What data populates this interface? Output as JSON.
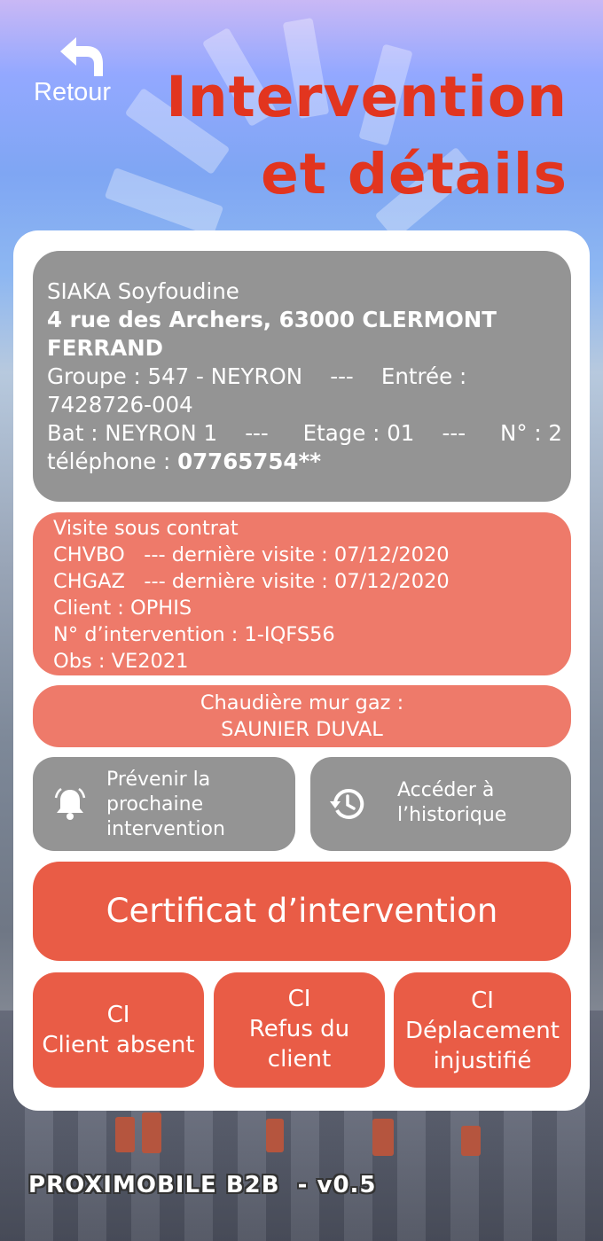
{
  "colors": {
    "title": "#e2351f",
    "info_box": "#949494",
    "contract_box": "#ee7a6a",
    "primary_button": "#e95c46",
    "card": "#ffffff"
  },
  "header": {
    "back_label": "Retour",
    "back_icon": "undo-arrow-icon",
    "title_line1": "Intervention",
    "title_line2": "et détails"
  },
  "client": {
    "name": "SIAKA Soyfoudine",
    "address_line1": "4 rue des Archers, 63000 CLERMONT",
    "address_line2": "FERRAND",
    "group_line": "Groupe : 547 - NEYRON    ---    Entrée :",
    "entry_value": "7428726-004",
    "building_line": "Bat : NEYRON 1    ---     Etage : 01    ---     N° : 2",
    "phone_label": "téléphone : ",
    "phone_value": "07765754**"
  },
  "contract": {
    "title": "Visite sous contrat",
    "line1": "CHVBO   --- dernière visite : 07/12/2020",
    "line2": "CHGAZ   --- dernière visite : 07/12/2020",
    "client": "Client : OPHIS",
    "intervention": "N° d’intervention : 1-IQFS56",
    "obs": "Obs : VE2021"
  },
  "boiler": {
    "line1": "Chaudière mur gaz :",
    "line2": "SAUNIER DUVAL"
  },
  "actions": {
    "notify": {
      "icon": "bell-icon",
      "line1": "Prévenir la",
      "line2": "prochaine",
      "line3": "intervention"
    },
    "history": {
      "icon": "history-icon",
      "line1": "Accéder à",
      "line2": "l’historique"
    },
    "certificate": "Certificat d’intervention",
    "ci_absent": {
      "line1": "CI",
      "line2": "Client absent"
    },
    "ci_refus": {
      "line1": "CI",
      "line2": "Refus du",
      "line3": "client"
    },
    "ci_deplacement": {
      "line1": "CI",
      "line2": "Déplacement",
      "line3": "injustifié"
    }
  },
  "footer": {
    "app_version": "PROXIMOBILE B2B  - v0.5"
  }
}
